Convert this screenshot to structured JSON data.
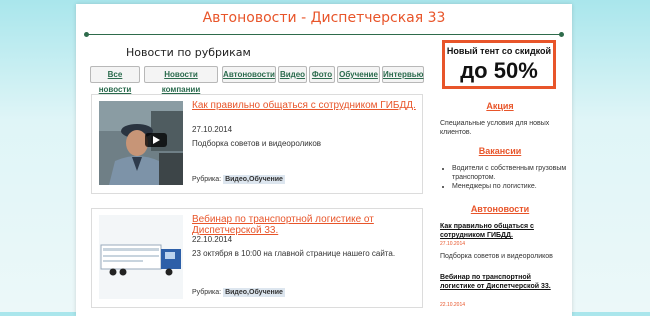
{
  "header": {
    "title": "Автоновости - Диспетчерская 33"
  },
  "rubrics": {
    "heading": "Новости по рубрикам",
    "tabs": [
      "Все новости",
      "Новости компании",
      "Автоновости",
      "Видео",
      "Фото",
      "Обучение",
      "Интервью"
    ]
  },
  "news": [
    {
      "title": "Как правильно общаться с сотрудником ГИБДД.",
      "date": "27.10.2014",
      "desc": "Подборка советов и видеороликов",
      "rubric_label": "Рубрика:",
      "rubric": "Видео,Обучение",
      "thumb_icon": "play-icon"
    },
    {
      "title": "Вебинар по транспортной логистике от Диспетчерской 33.",
      "date": "22.10.2014",
      "desc": "23 октября в 10:00 на главной странице нашего сайта.",
      "rubric_label": "Рубрика:",
      "rubric": "Видео,Обучение",
      "thumb_icon": "truck-icon"
    }
  ],
  "sidebar": {
    "promo": {
      "line1": "Новый тент со скидкой",
      "line2": "до 50%",
      "border_color": "#e8552a"
    },
    "action_heading": "Акция",
    "action_text": "Специальные условия для новых клиентов.",
    "vacancies_heading": "Вакансии",
    "vacancies": [
      "Водители с собственным грузовым транспортом.",
      "Менеджеры по логистике."
    ],
    "autonews_heading": "Автоновости",
    "autonews": [
      {
        "title": "Как правильно общаться с сотрудником ГИБДД.",
        "date": "27.10.2014",
        "desc": "Подборка советов и видеороликов"
      },
      {
        "title": "Вебинар по транспортной логистике от Диспетчерской 33.",
        "date": "22.10.2014"
      }
    ]
  },
  "colors": {
    "accent": "#e8552a",
    "link_green": "#2a6b4d",
    "background": "#a9e6ec"
  }
}
